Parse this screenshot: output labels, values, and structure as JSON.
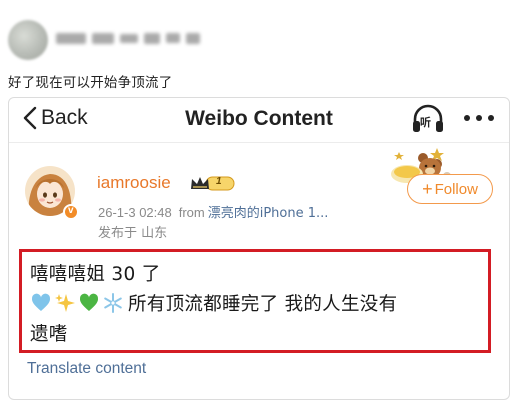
{
  "outer_post": {
    "caption": "好了现在可以开始争顶流了"
  },
  "weibo": {
    "nav": {
      "back_label": "Back",
      "title": "Weibo Content",
      "listen_label": "听",
      "icons": {
        "back": "chevron-left-icon",
        "listen": "headphones-icon",
        "more": "more-dots-icon"
      }
    },
    "author": {
      "username": "iamroosie",
      "member_level": "1",
      "verified_badge": "v",
      "timestamp": "26-1-3 02:48",
      "from_label": "from",
      "source": "漂亮肉的iPhone 1...",
      "location": "发布于 山东"
    },
    "follow": {
      "label": "Follow",
      "plus": "+"
    },
    "post": {
      "line1": "嘻嘻嘻姐 30 了",
      "emojis": [
        "blue-heart",
        "sparkles",
        "green-heart",
        "snowflake"
      ],
      "line2_text": "所有顶流都睡完了 我的人生没有",
      "line3": "遗嗜"
    },
    "translate_label": "Translate content"
  },
  "colors": {
    "username": "#e8782a",
    "follow": "#f08a2c",
    "link": "#4f6f97",
    "highlight_box": "#d31c24"
  }
}
